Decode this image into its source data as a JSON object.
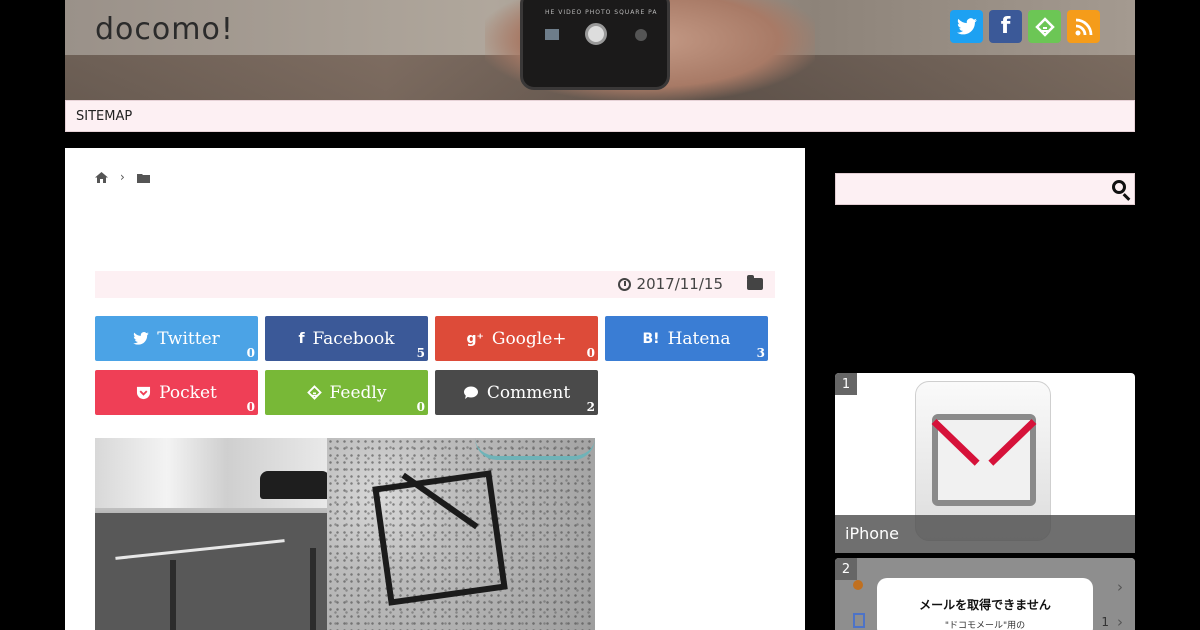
{
  "header": {
    "site_title": "docomo!",
    "camera_modes": "HE VIDEO PHOTO SQUARE PA",
    "social_icons": [
      {
        "name": "twitter-icon",
        "color": "#1da1f2",
        "glyph": "t"
      },
      {
        "name": "facebook-icon",
        "color": "#3b5998",
        "glyph": "f"
      },
      {
        "name": "feedly-icon",
        "color": "#6cc655",
        "glyph": "◈"
      },
      {
        "name": "rss-icon",
        "color": "#f59c1a",
        "glyph": ")"
      }
    ]
  },
  "nav": {
    "sitemap": "SITEMAP"
  },
  "article": {
    "date": "2017/11/15",
    "share_buttons": [
      {
        "label": "Twitter",
        "count": "0",
        "color": "#4ba3e6",
        "icon": "twitter-icon",
        "glyph": "🐦"
      },
      {
        "label": "Facebook",
        "count": "5",
        "color": "#3b5998",
        "icon": "facebook-icon",
        "glyph": "f"
      },
      {
        "label": "Google+",
        "count": "0",
        "color": "#dd4b39",
        "icon": "google-plus-icon",
        "glyph": "g+"
      },
      {
        "label": "Hatena",
        "count": "3",
        "color": "#3a7dd4",
        "icon": "hatena-icon",
        "glyph": "B!"
      },
      {
        "label": "Pocket",
        "count": "0",
        "color": "#ef3f56",
        "icon": "pocket-icon",
        "glyph": "♥"
      },
      {
        "label": "Feedly",
        "count": "0",
        "color": "#78b837",
        "icon": "feedly-icon",
        "glyph": "◈"
      },
      {
        "label": "Comment",
        "count": "2",
        "color": "#4a4a4a",
        "icon": "comment-icon",
        "glyph": "●"
      }
    ]
  },
  "sidebar": {
    "search_placeholder": "",
    "ranking": [
      {
        "rank": "1",
        "caption": "iPhone"
      },
      {
        "rank": "2",
        "dialog_title": "メールを取得できません",
        "dialog_sub": "\"ドコモメール\"用の",
        "count": "1"
      }
    ]
  }
}
